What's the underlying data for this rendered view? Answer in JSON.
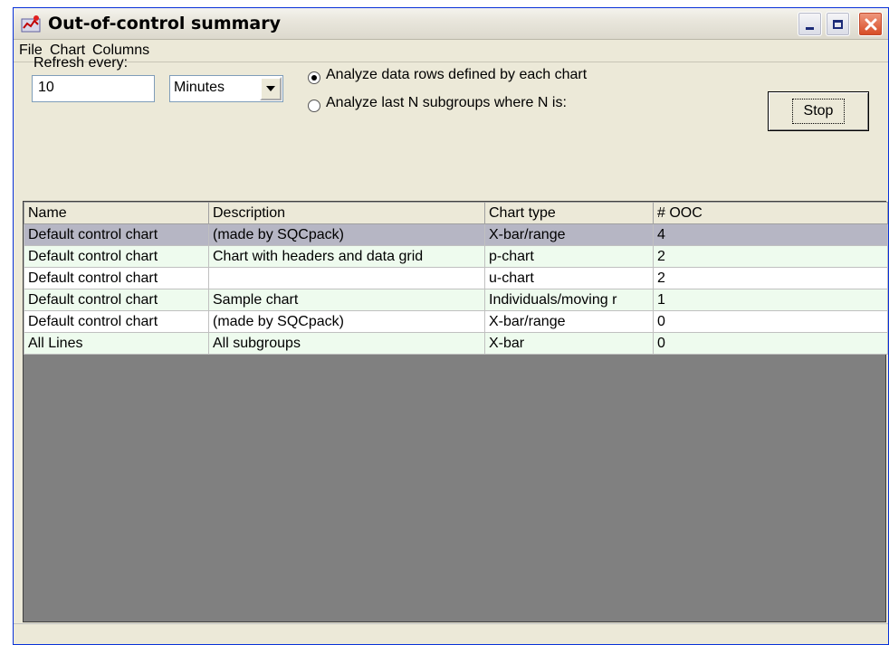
{
  "window": {
    "title": "Out-of-control summary"
  },
  "menu": [
    "File",
    "Chart",
    "Columns"
  ],
  "refresh": {
    "label": "Refresh every:",
    "value": "10",
    "unit": "Minutes"
  },
  "options": {
    "rows_defined": "Analyze data rows defined  by each chart",
    "last_n": "Analyze last N subgroups where N is:"
  },
  "stop_button": "Stop",
  "table": {
    "columns": [
      "Name",
      "Description",
      "Chart type",
      "# OOC"
    ],
    "rows": [
      [
        "Default control chart",
        "(made by SQCpack)",
        "X-bar/range",
        "4"
      ],
      [
        "Default control chart",
        "Chart with headers and data grid",
        "p-chart",
        "2"
      ],
      [
        "Default control chart",
        "",
        "u-chart",
        "2"
      ],
      [
        "Default control chart",
        "Sample chart",
        "Individuals/moving r",
        "1"
      ],
      [
        "Default control chart",
        "(made by SQCpack)",
        "X-bar/range",
        "0"
      ],
      [
        "All Lines",
        "All subgroups",
        "X-bar",
        "0"
      ]
    ]
  }
}
